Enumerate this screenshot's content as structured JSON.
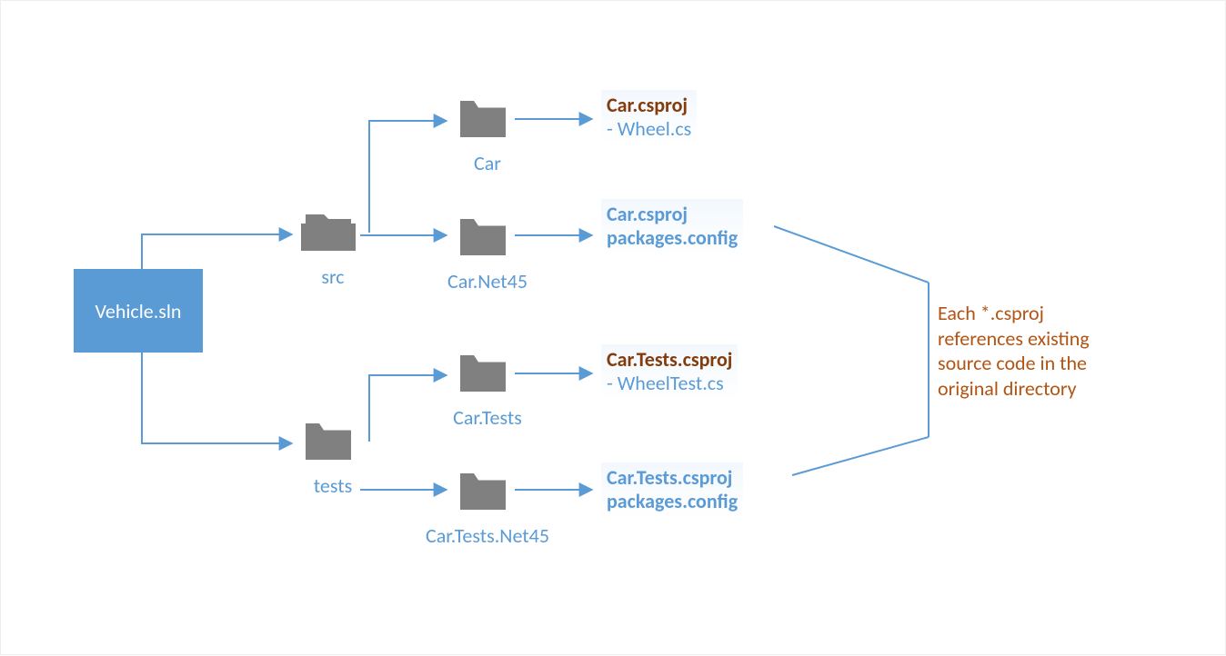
{
  "solution": {
    "name": "Vehicle.sln"
  },
  "folders": {
    "src": {
      "label": "src"
    },
    "tests": {
      "label": "tests"
    },
    "car": {
      "label": "Car"
    },
    "carNet45": {
      "label": "Car.Net45"
    },
    "carTests": {
      "label": "Car.Tests"
    },
    "carTestsNet45": {
      "label": "Car.Tests.Net45"
    }
  },
  "files": {
    "car": {
      "proj": "Car.csproj",
      "line2": "- Wheel.cs"
    },
    "carNet45": {
      "proj": "Car.csproj",
      "line2": "packages.config"
    },
    "carTests": {
      "proj": "Car.Tests.csproj",
      "line2": "- WheelTest.cs"
    },
    "carTestsNet45": {
      "proj": "Car.Tests.csproj",
      "line2": "packages.config"
    }
  },
  "note": {
    "l1": "Each *.csproj",
    "l2": "references existing",
    "l3": "source code in the",
    "l4": "original directory"
  }
}
